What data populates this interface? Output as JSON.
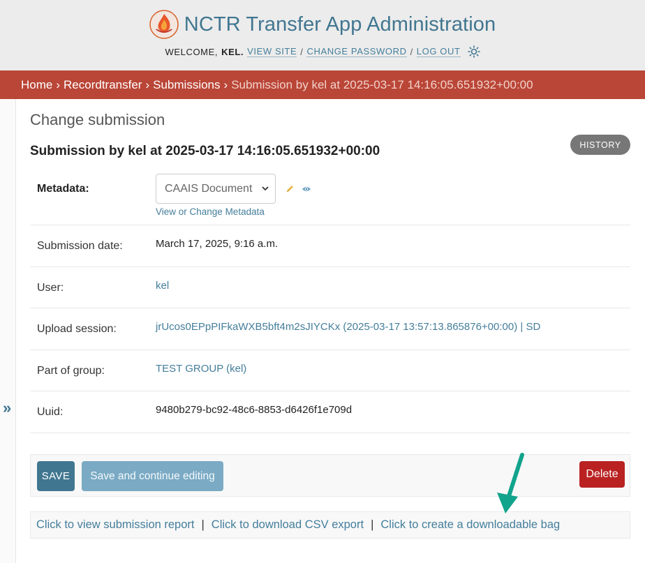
{
  "header": {
    "site_title": "NCTR Transfer App Administration",
    "welcome_label": "Welcome,",
    "username": "kel",
    "username_suffix": ".",
    "view_site": "View site",
    "change_password": "Change password",
    "log_out": "Log out",
    "separator": "/"
  },
  "breadcrumbs": {
    "home": "Home",
    "app": "Recordtransfer",
    "model": "Submissions",
    "current": "Submission by kel at 2025-03-17 14:16:05.651932+00:00",
    "separator": "›"
  },
  "sidebar": {
    "toggle_glyph": "»"
  },
  "content": {
    "page_title": "Change submission",
    "object_title": "Submission by kel at 2025-03-17 14:16:05.651932+00:00",
    "history_label": "HISTORY"
  },
  "form": {
    "metadata": {
      "label": "Metadata:",
      "selected": "CAAIS Document",
      "link": "View or Change Metadata"
    },
    "submission_date": {
      "label": "Submission date:",
      "value": "March 17, 2025, 9:16 a.m."
    },
    "user": {
      "label": "User:",
      "value": "kel"
    },
    "upload_session": {
      "label": "Upload session:",
      "value": "jrUcos0EPpPIFkaWXB5bft4m2sJIYCKx (2025-03-17 13:57:13.865876+00:00) | SD"
    },
    "part_of_group": {
      "label": "Part of group:",
      "value": "TEST GROUP (kel)"
    },
    "uuid": {
      "label": "Uuid:",
      "value": "9480b279-bc92-48c6-8853-d6426f1e709d"
    }
  },
  "submit": {
    "save": "SAVE",
    "save_continue": "Save and continue editing",
    "delete": "Delete"
  },
  "exports": {
    "report": "Click to view submission report",
    "csv": "Click to download CSV export",
    "bag": "Click to create a downloadable bag",
    "separator": "|"
  },
  "colors": {
    "brand_blue": "#417690",
    "breadcrumb_red": "#ba4637",
    "link_blue": "#447e9b",
    "delete_red": "#ba2121",
    "arrow_teal": "#12a38c"
  },
  "icons": [
    "flame-logo-icon",
    "theme-toggle-icon",
    "pencil-icon",
    "eye-icon",
    "chevron-down-icon",
    "expand-sidebar-icon"
  ]
}
